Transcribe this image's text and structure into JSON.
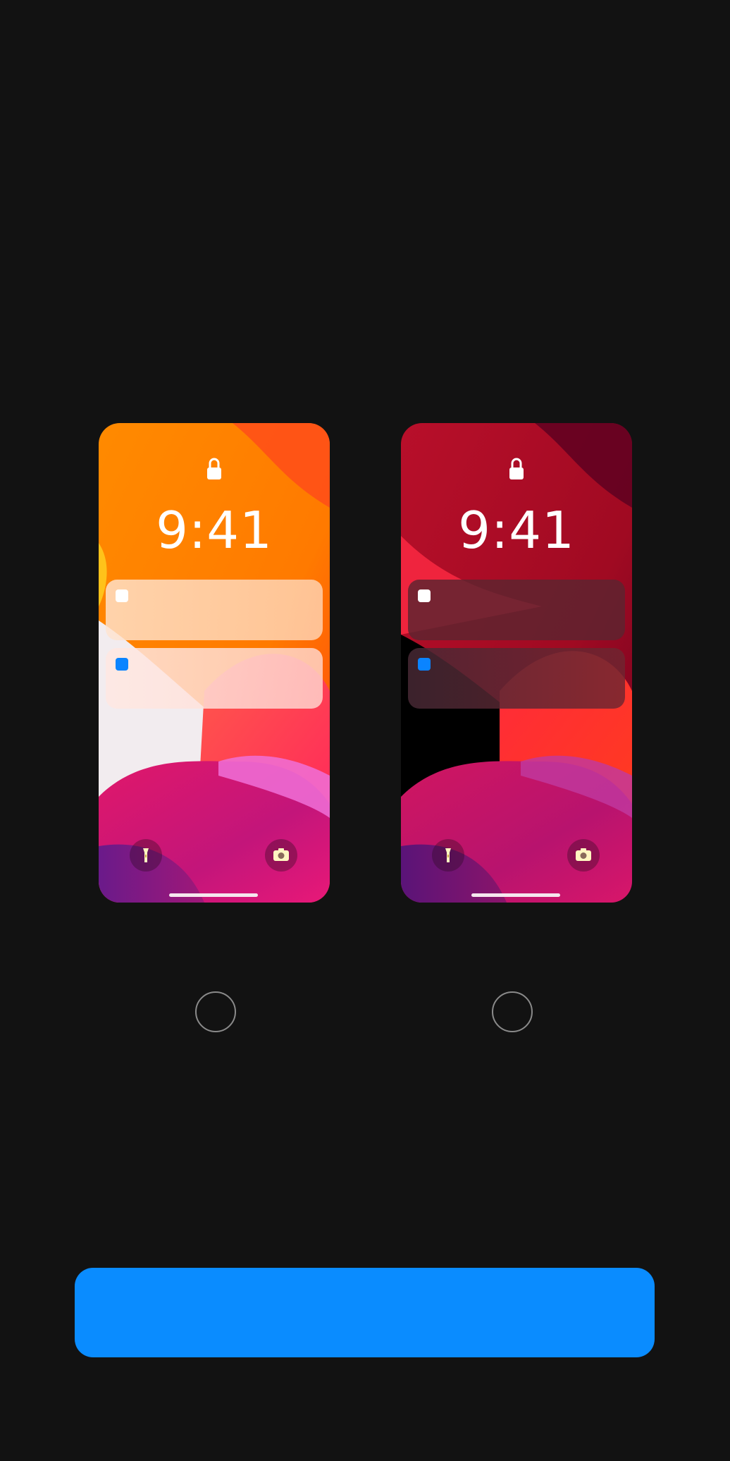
{
  "appearance_options": [
    {
      "id": "light",
      "time": "9:41",
      "selected": false
    },
    {
      "id": "dark",
      "time": "9:41",
      "selected": false
    }
  ],
  "button": {
    "label": ""
  },
  "colors": {
    "background": "#121212",
    "button": "#0a8cff",
    "radio_border": "#8a8a8a",
    "app_icon_white": "#ffffff",
    "app_icon_blue": "#0a84ff"
  },
  "icons": {
    "lock": "lock-icon",
    "flashlight": "flashlight-icon",
    "camera": "camera-icon"
  }
}
